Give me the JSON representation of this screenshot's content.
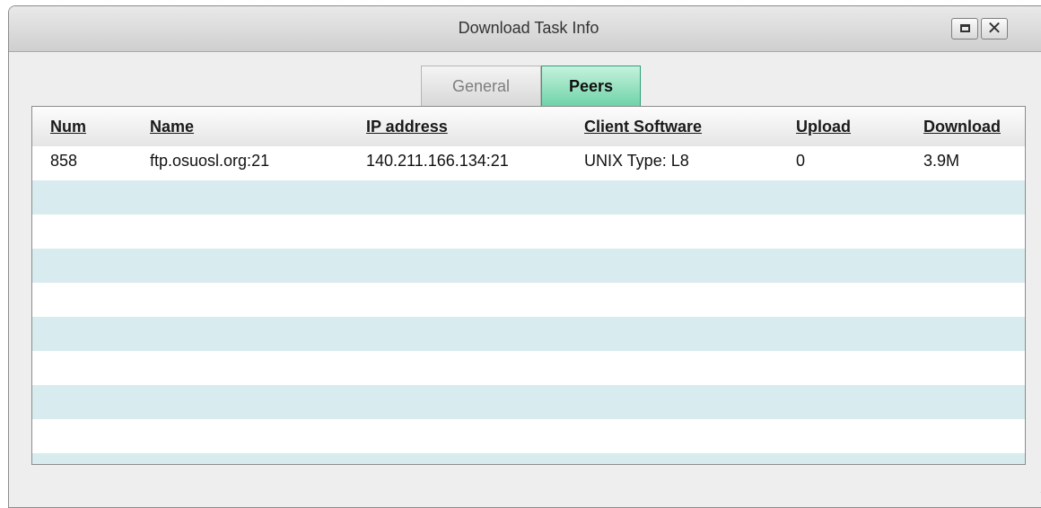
{
  "window": {
    "title": "Download Task Info",
    "maximize_icon": "maximize-icon",
    "close_icon": "close-icon",
    "close_glyph": "✕"
  },
  "tabs": [
    {
      "label": "General",
      "selected": false
    },
    {
      "label": "Peers",
      "selected": true
    }
  ],
  "table": {
    "columns": [
      "Num",
      "Name",
      "IP address",
      "Client Software",
      "Upload",
      "Download"
    ],
    "rows": [
      {
        "num": "858",
        "name": "ftp.osuosl.org:21",
        "ip": "140.211.166.134:21",
        "client": "UNIX Type: L8",
        "upload": "0",
        "download": "3.9M"
      }
    ],
    "empty_rows": 8,
    "stripe_color": "#d8ebee"
  },
  "colors": {
    "accent_tab": "#6fd3a8",
    "titlebar": "#d9d9d9"
  }
}
